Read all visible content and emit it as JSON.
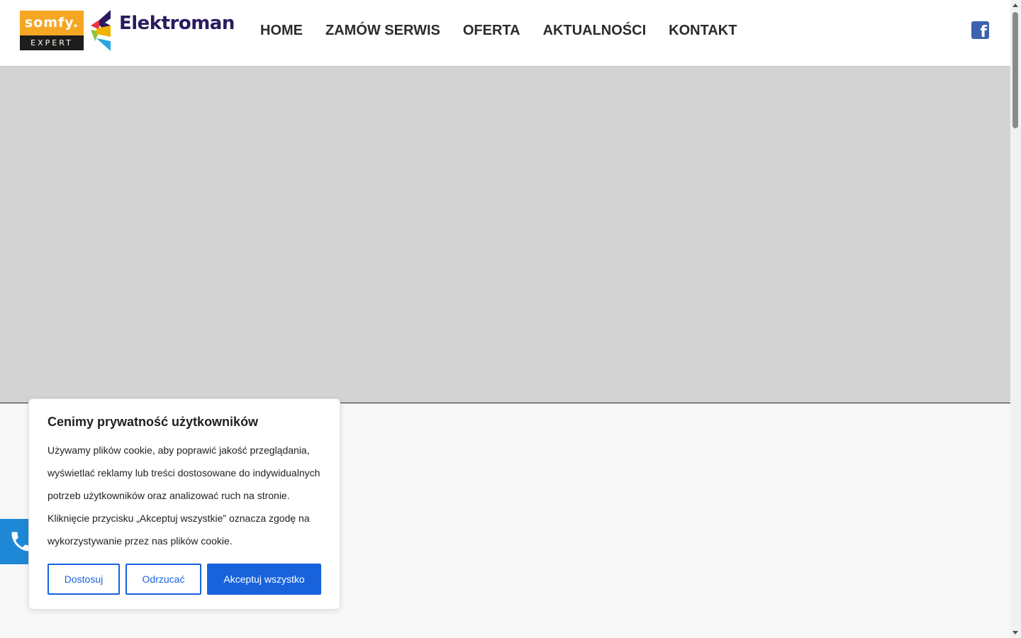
{
  "header": {
    "somfy_logo": {
      "top": "somfy.",
      "bottom": "EXPERT"
    },
    "brand_name": "Elektroman",
    "nav": [
      {
        "label": "HOME"
      },
      {
        "label": "ZAMÓW SERWIS"
      },
      {
        "label": "OFERTA"
      },
      {
        "label": "AKTUALNOŚCI"
      },
      {
        "label": "KONTAKT"
      }
    ],
    "social_icon": "facebook-icon",
    "social_glyph": "f"
  },
  "phone_button": {
    "icon": "phone-icon"
  },
  "cookie_banner": {
    "title": "Cenimy prywatność użytkowników",
    "paragraph1": "Używamy plików cookie, aby poprawić jakość przeglądania, wyświetlać reklamy lub treści dostosowane do indywidualnych potrzeb użytkowników oraz analizować ruch na stronie.",
    "paragraph2": "Kliknięcie przycisku „Akceptuj wszystkie” oznacza zgodę na wykorzystywanie przez nas plików cookie.",
    "buttons": {
      "customize": "Dostosuj",
      "reject": "Odrzucać",
      "accept": "Akceptuj wszystko"
    }
  },
  "colors": {
    "accent": "#1863dc",
    "hero_bg": "#d3d3d3",
    "somfy_orange": "#f5a623",
    "brand_purple": "#2a1a5e",
    "phone_blue": "#1e88d6"
  }
}
